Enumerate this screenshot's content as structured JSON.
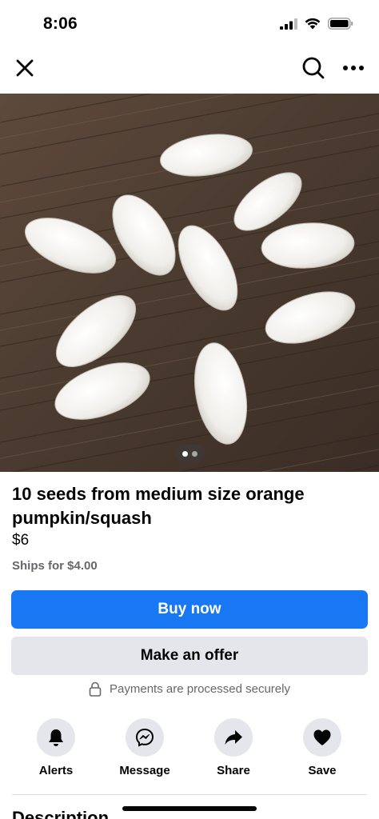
{
  "status_bar": {
    "time": "8:06",
    "icons": [
      "signal-icon",
      "wifi-icon",
      "battery-icon"
    ]
  },
  "topbar": {
    "icons": [
      "close-icon",
      "search-icon",
      "more-icon"
    ]
  },
  "listing": {
    "photo_count": 2,
    "active_photo": 1,
    "title": "10 seeds from medium size orange pumpkin/squash",
    "price": "$6",
    "shipping": "Ships for $4.00"
  },
  "buttons": {
    "buy_now": "Buy now",
    "make_offer": "Make an offer"
  },
  "secure_note": {
    "icon": "lock-icon",
    "text": "Payments are processed securely"
  },
  "actions": [
    {
      "label": "Alerts",
      "icon": "bell-icon"
    },
    {
      "label": "Message",
      "icon": "messenger-icon"
    },
    {
      "label": "Share",
      "icon": "share-icon"
    },
    {
      "label": "Save",
      "icon": "heart-icon"
    }
  ],
  "description": {
    "heading": "Description"
  },
  "colors": {
    "primary": "#1877f2",
    "secondary_button": "#e4e6eb",
    "muted_text": "#65676b"
  }
}
